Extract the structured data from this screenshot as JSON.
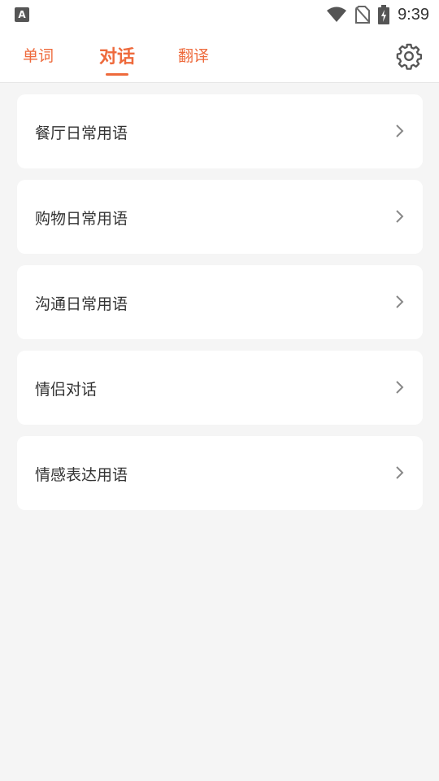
{
  "status_bar": {
    "left_icon": "A",
    "time": "9:39",
    "icons": [
      "wifi-icon",
      "no-sim-icon",
      "battery-charging-icon"
    ]
  },
  "tabs": [
    {
      "label": "单词",
      "active": false
    },
    {
      "label": "对话",
      "active": true
    },
    {
      "label": "翻译",
      "active": false
    }
  ],
  "settings_icon": "gear-icon",
  "accent_color": "#ee6a3c",
  "items": [
    {
      "label": "餐厅日常用语"
    },
    {
      "label": "购物日常用语"
    },
    {
      "label": "沟通日常用语"
    },
    {
      "label": "情侣对话"
    },
    {
      "label": "情感表达用语"
    }
  ]
}
